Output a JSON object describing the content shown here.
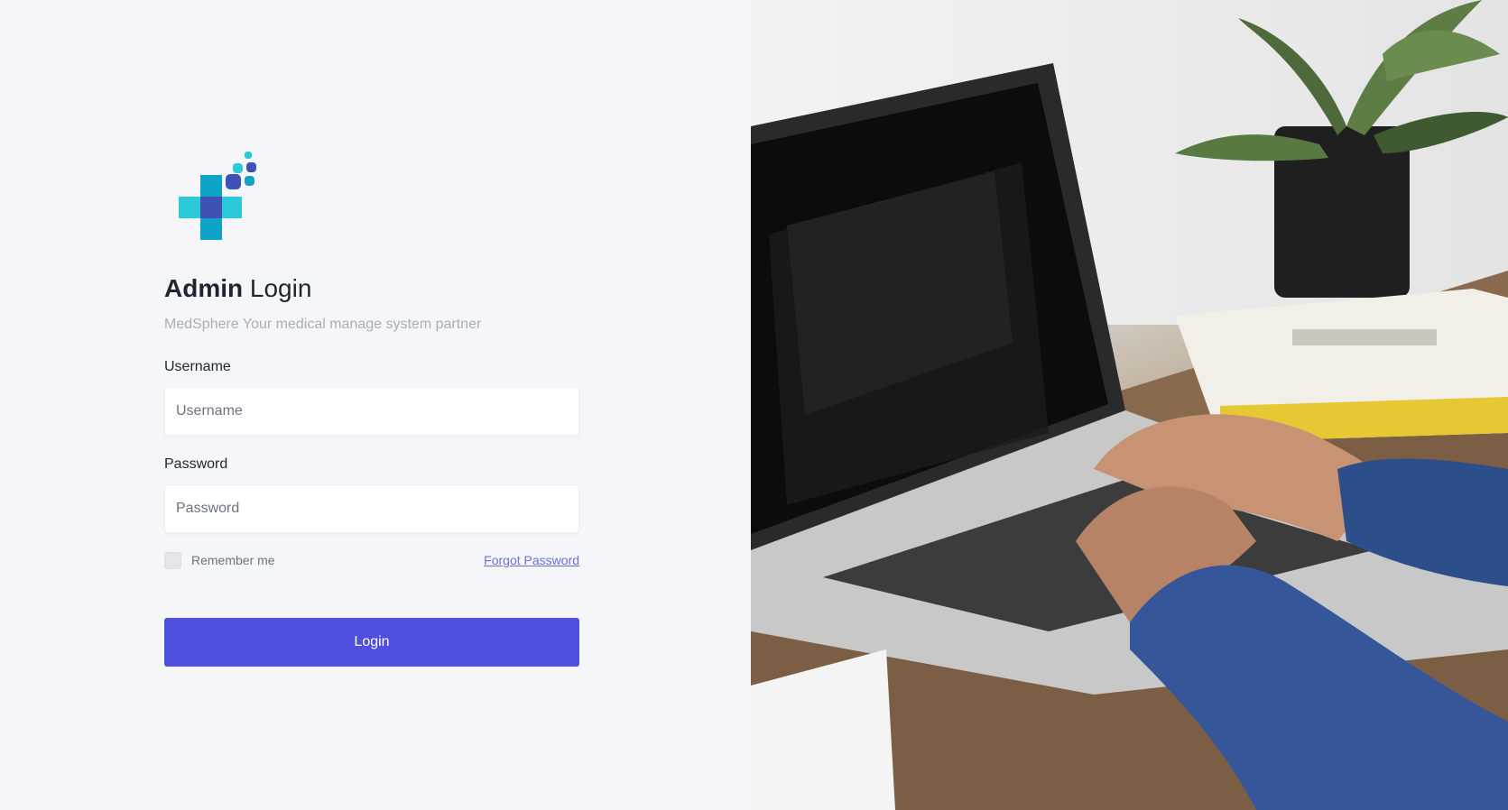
{
  "login": {
    "title_strong": "Admin",
    "title_light": "Login",
    "subtitle": "MedSphere Your medical manage system partner",
    "username_label": "Username",
    "username_placeholder": "Username",
    "password_label": "Password",
    "password_placeholder": "Password",
    "remember_label": "Remember me",
    "remember_checked": false,
    "forgot_label": "Forgot Password",
    "login_button": "Login"
  },
  "colors": {
    "primary": "#5050e0",
    "link": "#6b6ee0",
    "logo_teal": "#2cc9d8",
    "logo_blue": "#0fa3c8",
    "logo_indigo": "#3f51b5"
  },
  "hero": {
    "image": "laptop-typing-photo"
  }
}
